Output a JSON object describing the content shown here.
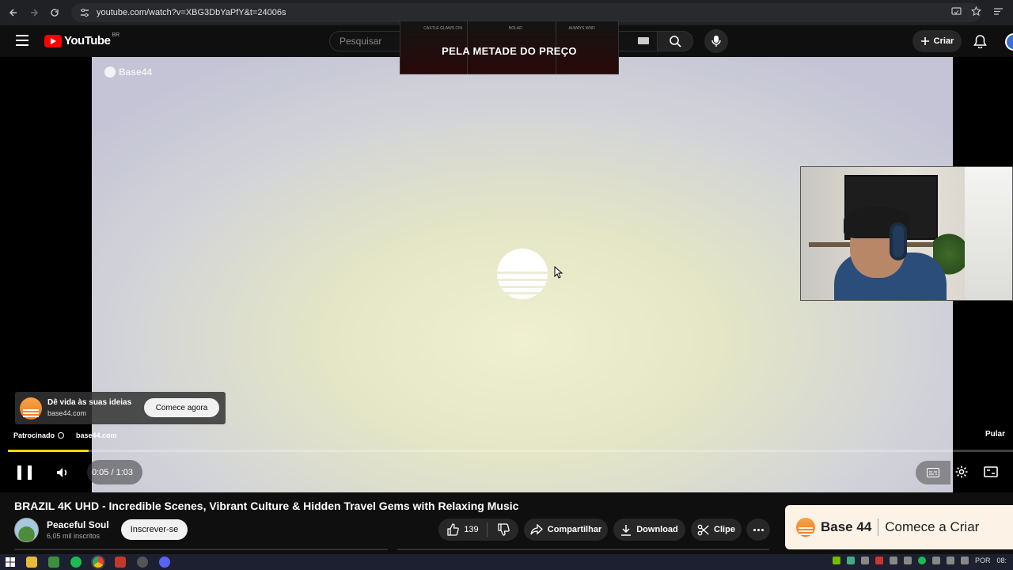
{
  "browser": {
    "url": "youtube.com/watch?v=XBG3DbYaPfY&t=24006s"
  },
  "yt_header": {
    "logo_word": "YouTube",
    "country": "BR",
    "search_placeholder": "Pesquisar",
    "create_label": "Criar"
  },
  "promo_banner": {
    "label_left": "CASTLE GLAWS CIN",
    "label_center": "NOLAD",
    "label_right": "ALWAYS WND",
    "headline": "PELA METADE DO PREÇO"
  },
  "player": {
    "watermark": "Base44",
    "ad_title": "Dê vida às suas ideias",
    "ad_domain": "base44.com",
    "ad_cta": "Comece agora",
    "sponsored_label": "Patrocinado",
    "sponsored_domain": "base44.com",
    "skip_label": "Pular",
    "time": "0:05 / 1:03",
    "progress_fraction": 0.08,
    "accent_color": "#f5d800"
  },
  "video": {
    "title": "BRAZIL 4K UHD - Incredible Scenes, Vibrant Culture & Hidden Travel Gems with Relaxing Music",
    "channel_name": "Peaceful Soul",
    "channel_subs": "6,05 mil inscritos",
    "subscribe_label": "Inscrever-se",
    "likes": "139",
    "share_label": "Compartilhar",
    "download_label": "Download",
    "clip_label": "Clipe"
  },
  "side_ad": {
    "brand": "Base 44",
    "tagline": "Comece a Criar"
  },
  "taskbar": {
    "lang": "POR",
    "clock": "08:"
  },
  "icons": {
    "back": "arrow-left-icon",
    "forward": "arrow-right-icon",
    "reload": "reload-icon",
    "search": "search-icon",
    "mic": "mic-icon",
    "bell": "bell-icon",
    "like": "thumbs-up-icon",
    "dislike": "thumbs-down-icon",
    "share": "share-icon",
    "download": "download-icon",
    "clip": "scissors-icon"
  }
}
